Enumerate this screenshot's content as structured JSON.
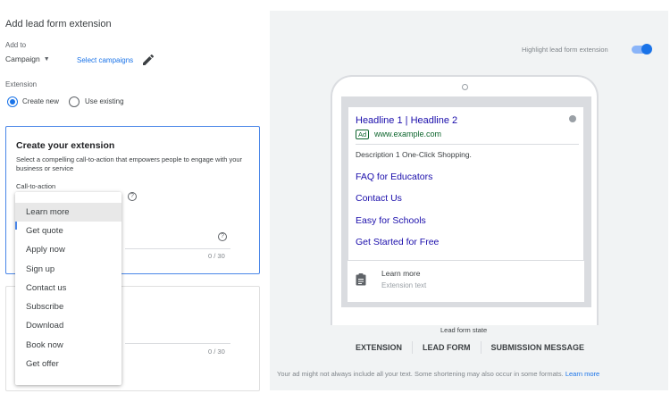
{
  "page": {
    "title": "Add lead form extension"
  },
  "add_to": {
    "label": "Add to",
    "selected": "Campaign",
    "select_link": "Select campaigns"
  },
  "extension": {
    "label": "Extension",
    "options": [
      "Create new",
      "Use existing"
    ],
    "selected": "Create new"
  },
  "create": {
    "title": "Create your extension",
    "description": "Select a compelling call-to-action that empowers people to engage with your business or service",
    "cta_label": "Call-to-action",
    "counter1": "0 / 30",
    "counter2": "0 / 30"
  },
  "dropdown": {
    "options": [
      "Learn more",
      "Get quote",
      "Apply now",
      "Sign up",
      "Contact us",
      "Subscribe",
      "Download",
      "Book now",
      "Get offer"
    ],
    "highlighted": "Learn more"
  },
  "preview": {
    "highlight_label": "Highlight lead form extension",
    "highlight_on": true,
    "ad": {
      "headline": "Headline 1 | Headline 2",
      "badge": "Ad",
      "url": "www.example.com",
      "description": "Description 1 One-Click Shopping.",
      "sitelinks": [
        "FAQ for Educators",
        "Contact Us",
        "Easy for Schools",
        "Get Started for Free"
      ]
    },
    "extension_row": {
      "cta": "Learn more",
      "text": "Extension text"
    },
    "state_label": "Lead form state",
    "states": [
      "EXTENSION",
      "LEAD FORM",
      "SUBMISSION MESSAGE"
    ],
    "footer_note": "Your ad might not always include all your text. Some shortening may also occur in some formats.",
    "footer_link": "Learn more"
  },
  "colors": {
    "accent": "#1a73e8",
    "ad_link": "#1a0dab",
    "ad_url": "#0d652d"
  }
}
